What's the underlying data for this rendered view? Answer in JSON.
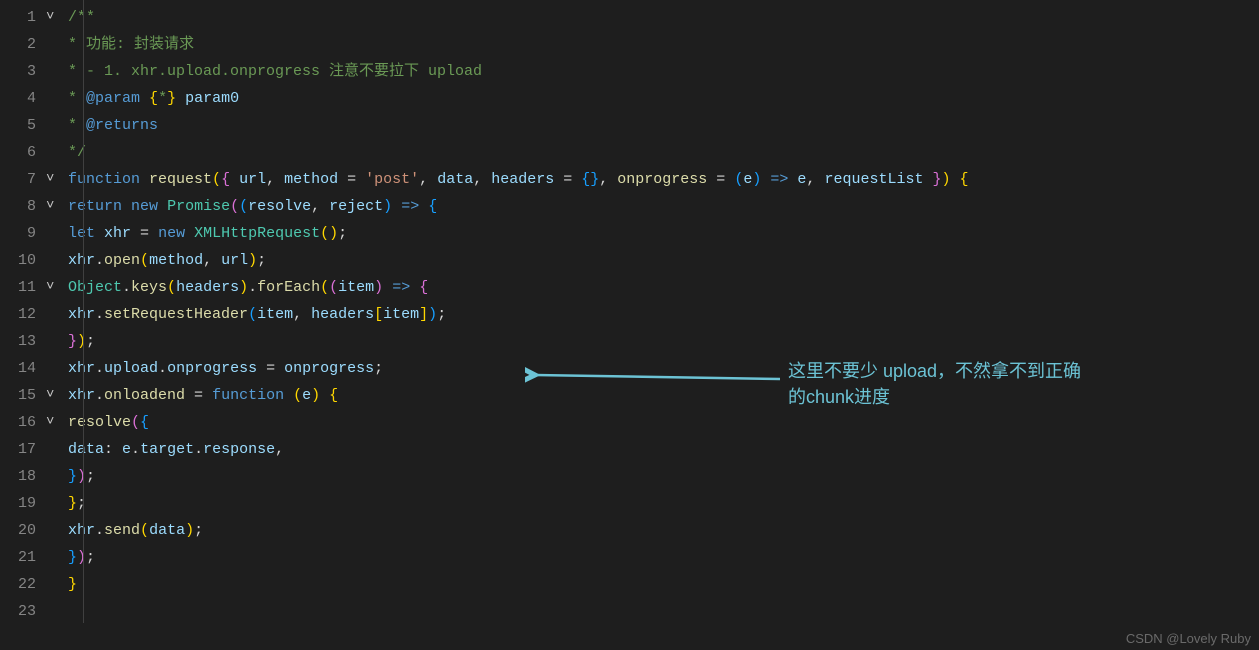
{
  "lines": [
    {
      "n": 1,
      "fold": "˅"
    },
    {
      "n": 2,
      "fold": ""
    },
    {
      "n": 3,
      "fold": ""
    },
    {
      "n": 4,
      "fold": ""
    },
    {
      "n": 5,
      "fold": ""
    },
    {
      "n": 6,
      "fold": ""
    },
    {
      "n": 7,
      "fold": "˅"
    },
    {
      "n": 8,
      "fold": "˅"
    },
    {
      "n": 9,
      "fold": ""
    },
    {
      "n": 10,
      "fold": ""
    },
    {
      "n": 11,
      "fold": "˅"
    },
    {
      "n": 12,
      "fold": ""
    },
    {
      "n": 13,
      "fold": ""
    },
    {
      "n": 14,
      "fold": ""
    },
    {
      "n": 15,
      "fold": "˅"
    },
    {
      "n": 16,
      "fold": "˅"
    },
    {
      "n": 17,
      "fold": ""
    },
    {
      "n": 18,
      "fold": ""
    },
    {
      "n": 19,
      "fold": ""
    },
    {
      "n": 20,
      "fold": ""
    },
    {
      "n": 21,
      "fold": ""
    },
    {
      "n": 22,
      "fold": ""
    },
    {
      "n": 23,
      "fold": ""
    }
  ],
  "code": {
    "l1": [
      [
        "cm",
        "/**"
      ]
    ],
    "l2": [
      [
        "cm",
        " * 功能: 封装请求"
      ]
    ],
    "l3": [
      [
        "cm",
        " * - 1. xhr.upload.onprogress 注意不要拉下 upload"
      ]
    ],
    "l4": [
      [
        "cm",
        " * "
      ],
      [
        "tg",
        "@param"
      ],
      [
        "cm",
        " "
      ],
      [
        "par",
        "{"
      ],
      [
        "cm",
        "*"
      ],
      [
        "par",
        "}"
      ],
      [
        "cm",
        " "
      ],
      [
        "vr",
        "param0"
      ]
    ],
    "l5": [
      [
        "cm",
        " * "
      ],
      [
        "tg",
        "@returns"
      ]
    ],
    "l6": [
      [
        "cm",
        " */"
      ]
    ],
    "l7": [
      [
        "kw",
        "function"
      ],
      [
        "pn",
        " "
      ],
      [
        "fn",
        "request"
      ],
      [
        "par",
        "("
      ],
      [
        "parP",
        "{"
      ],
      [
        "pn",
        " "
      ],
      [
        "vr",
        "url"
      ],
      [
        "pn",
        ", "
      ],
      [
        "vr",
        "method"
      ],
      [
        "pn",
        " = "
      ],
      [
        "st",
        "'post'"
      ],
      [
        "pn",
        ", "
      ],
      [
        "vr",
        "data"
      ],
      [
        "pn",
        ", "
      ],
      [
        "vr",
        "headers"
      ],
      [
        "pn",
        " = "
      ],
      [
        "parB",
        "{}"
      ],
      [
        "pn",
        ", "
      ],
      [
        "fn",
        "onprogress"
      ],
      [
        "pn",
        " = "
      ],
      [
        "parB",
        "("
      ],
      [
        "vr",
        "e"
      ],
      [
        "parB",
        ")"
      ],
      [
        "pn",
        " "
      ],
      [
        "kw",
        "=>"
      ],
      [
        "pn",
        " "
      ],
      [
        "vr",
        "e"
      ],
      [
        "pn",
        ", "
      ],
      [
        "vr",
        "requestList"
      ],
      [
        "pn",
        " "
      ],
      [
        "parP",
        "}"
      ],
      [
        "par",
        ")"
      ],
      [
        "pn",
        " "
      ],
      [
        "par",
        "{"
      ]
    ],
    "l8": [
      [
        "pn",
        "  "
      ],
      [
        "kw",
        "return"
      ],
      [
        "pn",
        " "
      ],
      [
        "kw",
        "new"
      ],
      [
        "pn",
        " "
      ],
      [
        "cl",
        "Promise"
      ],
      [
        "parP",
        "("
      ],
      [
        "parB",
        "("
      ],
      [
        "vr",
        "resolve"
      ],
      [
        "pn",
        ", "
      ],
      [
        "vr",
        "reject"
      ],
      [
        "parB",
        ")"
      ],
      [
        "pn",
        " "
      ],
      [
        "kw",
        "=>"
      ],
      [
        "pn",
        " "
      ],
      [
        "parB",
        "{"
      ]
    ],
    "l9": [
      [
        "pn",
        "    "
      ],
      [
        "kw",
        "let"
      ],
      [
        "pn",
        " "
      ],
      [
        "vr",
        "xhr"
      ],
      [
        "pn",
        " = "
      ],
      [
        "kw",
        "new"
      ],
      [
        "pn",
        " "
      ],
      [
        "cl",
        "XMLHttpRequest"
      ],
      [
        "par",
        "()"
      ],
      [
        "pn",
        ";"
      ]
    ],
    "l10": [
      [
        "pn",
        "    "
      ],
      [
        "vr",
        "xhr"
      ],
      [
        "pn",
        "."
      ],
      [
        "fn",
        "open"
      ],
      [
        "par",
        "("
      ],
      [
        "vr",
        "method"
      ],
      [
        "pn",
        ", "
      ],
      [
        "vr",
        "url"
      ],
      [
        "par",
        ")"
      ],
      [
        "pn",
        ";"
      ]
    ],
    "l11": [
      [
        "pn",
        "    "
      ],
      [
        "cl",
        "Object"
      ],
      [
        "pn",
        "."
      ],
      [
        "fn",
        "keys"
      ],
      [
        "par",
        "("
      ],
      [
        "vr",
        "headers"
      ],
      [
        "par",
        ")"
      ],
      [
        "pn",
        "."
      ],
      [
        "fn",
        "forEach"
      ],
      [
        "par",
        "("
      ],
      [
        "parP",
        "("
      ],
      [
        "vr",
        "item"
      ],
      [
        "parP",
        ")"
      ],
      [
        "pn",
        " "
      ],
      [
        "kw",
        "=>"
      ],
      [
        "pn",
        " "
      ],
      [
        "parP",
        "{"
      ]
    ],
    "l12": [
      [
        "pn",
        "      "
      ],
      [
        "vr",
        "xhr"
      ],
      [
        "pn",
        "."
      ],
      [
        "fn",
        "setRequestHeader"
      ],
      [
        "parB",
        "("
      ],
      [
        "vr",
        "item"
      ],
      [
        "pn",
        ", "
      ],
      [
        "vr",
        "headers"
      ],
      [
        "par",
        "["
      ],
      [
        "vr",
        "item"
      ],
      [
        "par",
        "]"
      ],
      [
        "parB",
        ")"
      ],
      [
        "pn",
        ";"
      ]
    ],
    "l13": [
      [
        "pn",
        "    "
      ],
      [
        "parP",
        "}"
      ],
      [
        "par",
        ")"
      ],
      [
        "pn",
        ";"
      ]
    ],
    "l14": [
      [
        "pn",
        "    "
      ],
      [
        "vr",
        "xhr"
      ],
      [
        "pn",
        "."
      ],
      [
        "vr",
        "upload"
      ],
      [
        "pn",
        "."
      ],
      [
        "vr",
        "onprogress"
      ],
      [
        "pn",
        " = "
      ],
      [
        "vr",
        "onprogress"
      ],
      [
        "pn",
        ";"
      ]
    ],
    "l15": [
      [
        "pn",
        "    "
      ],
      [
        "vr",
        "xhr"
      ],
      [
        "pn",
        "."
      ],
      [
        "fn",
        "onloadend"
      ],
      [
        "pn",
        " = "
      ],
      [
        "kw",
        "function"
      ],
      [
        "pn",
        " "
      ],
      [
        "par",
        "("
      ],
      [
        "vr",
        "e"
      ],
      [
        "par",
        ")"
      ],
      [
        "pn",
        " "
      ],
      [
        "par",
        "{"
      ]
    ],
    "l16": [
      [
        "pn",
        "      "
      ],
      [
        "fn",
        "resolve"
      ],
      [
        "parP",
        "("
      ],
      [
        "parB",
        "{"
      ]
    ],
    "l17": [
      [
        "pn",
        "        "
      ],
      [
        "vr",
        "data"
      ],
      [
        "pn",
        ": "
      ],
      [
        "vr",
        "e"
      ],
      [
        "pn",
        "."
      ],
      [
        "vr",
        "target"
      ],
      [
        "pn",
        "."
      ],
      [
        "vr",
        "response"
      ],
      [
        "pn",
        ","
      ]
    ],
    "l18": [
      [
        "pn",
        "      "
      ],
      [
        "parB",
        "}"
      ],
      [
        "parP",
        ")"
      ],
      [
        "pn",
        ";"
      ]
    ],
    "l19": [
      [
        "pn",
        "    "
      ],
      [
        "par",
        "}"
      ],
      [
        "pn",
        ";"
      ]
    ],
    "l20": [
      [
        "pn",
        "    "
      ],
      [
        "vr",
        "xhr"
      ],
      [
        "pn",
        "."
      ],
      [
        "fn",
        "send"
      ],
      [
        "par",
        "("
      ],
      [
        "vr",
        "data"
      ],
      [
        "par",
        ")"
      ],
      [
        "pn",
        ";"
      ]
    ],
    "l21": [
      [
        "pn",
        "  "
      ],
      [
        "parB",
        "}"
      ],
      [
        "parP",
        ")"
      ],
      [
        "pn",
        ";"
      ]
    ],
    "l22": [
      [
        "par",
        "}"
      ]
    ],
    "l23": [
      [
        "pn",
        ""
      ]
    ]
  },
  "annotation": {
    "line1": "这里不要少 upload，不然拿不到正确",
    "line2": "的chunk进度"
  },
  "watermark": "CSDN @Lovely Ruby"
}
